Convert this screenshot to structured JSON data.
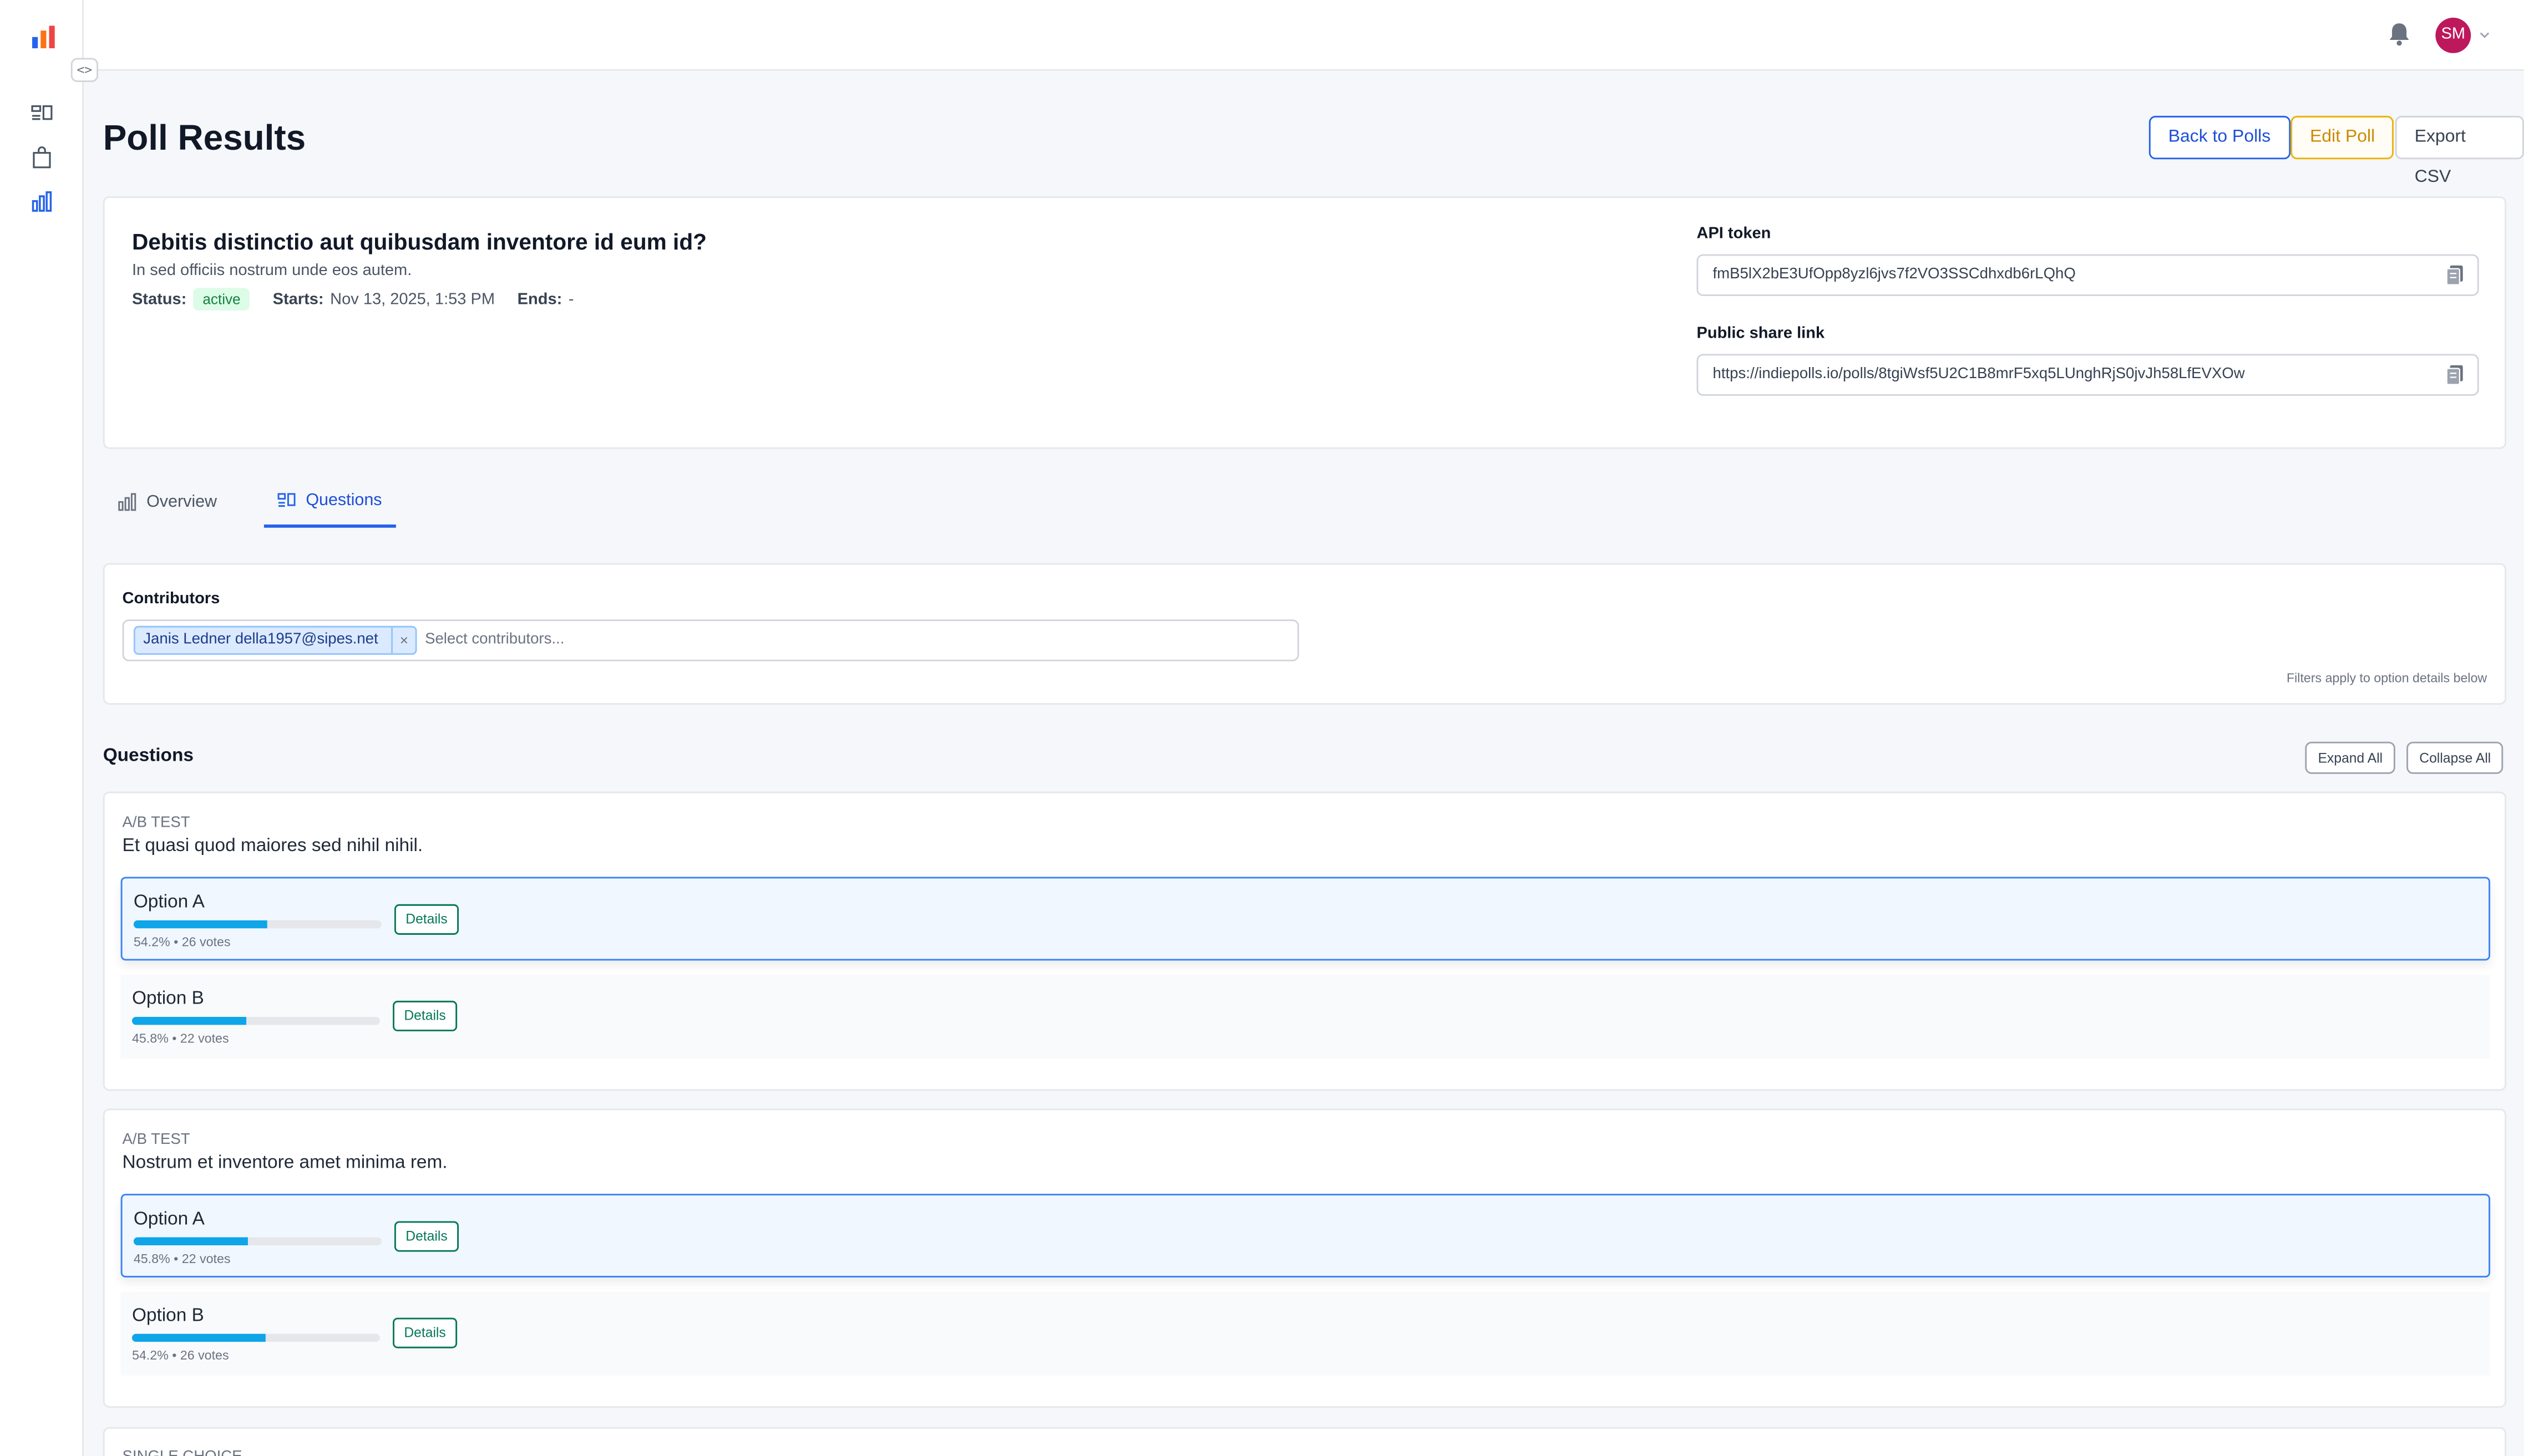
{
  "sidebar": {
    "collapse_label": "<>",
    "icons": [
      "logo-icon",
      "questions-icon",
      "shopping-bag-icon",
      "chart-icon"
    ],
    "colors": {
      "active": "#2563eb",
      "logo_blue": "#2563eb",
      "logo_orange": "#f97316",
      "logo_red": "#ef4444"
    }
  },
  "topbar": {
    "avatar_initials": "SM",
    "avatar_color": "#be185d"
  },
  "header": {
    "title": "Poll Results",
    "back_label": "Back to Polls",
    "edit_label": "Edit Poll",
    "export_label": "Export CSV"
  },
  "poll": {
    "question": "Debitis distinctio aut quibusdam inventore id eum id?",
    "description": "In sed officiis nostrum unde eos autem.",
    "status_label": "Status:",
    "status": "active",
    "starts_label": "Starts:",
    "starts": "Nov 13, 2025, 1:53 PM",
    "ends_label": "Ends:",
    "ends": "-",
    "api_token_label": "API token",
    "api_token": "fmB5lX2bE3UfOpp8yzl6jvs7f2VO3SSCdhxdb6rLQhQ",
    "share_label": "Public share link",
    "share_link": "https://indiepolls.io/polls/8tgiWsf5U2C1B8mrF5xq5LUnghRjS0jvJh58LfEVXOw"
  },
  "tabs": [
    {
      "label": "Overview",
      "active": false
    },
    {
      "label": "Questions",
      "active": true
    }
  ],
  "contributors": {
    "label": "Contributors",
    "selected": [
      "Janis Ledner della1957@sipes.net"
    ],
    "remove_label": "×",
    "placeholder": "Select contributors...",
    "filter_note": "Filters apply to option details below"
  },
  "questions": {
    "title": "Questions",
    "expand_label": "Expand All",
    "collapse_label": "Collapse All",
    "details_label": "Details",
    "items": [
      {
        "type": "A/B TEST",
        "text": "Et quasi quod maiores sed nihil nihil.",
        "options": [
          {
            "label": "Option A",
            "percent": 54.2,
            "stat": "54.2% • 26 votes",
            "selected": true
          },
          {
            "label": "Option B",
            "percent": 45.8,
            "stat": "45.8% • 22 votes",
            "selected": false
          }
        ]
      },
      {
        "type": "A/B TEST",
        "text": "Nostrum et inventore amet minima rem.",
        "options": [
          {
            "label": "Option A",
            "percent": 45.8,
            "stat": "45.8% • 22 votes",
            "selected": true
          },
          {
            "label": "Option B",
            "percent": 54.2,
            "stat": "54.2% • 26 votes",
            "selected": false
          }
        ]
      },
      {
        "type": "SINGLE CHOICE",
        "text": "",
        "options": []
      }
    ]
  }
}
